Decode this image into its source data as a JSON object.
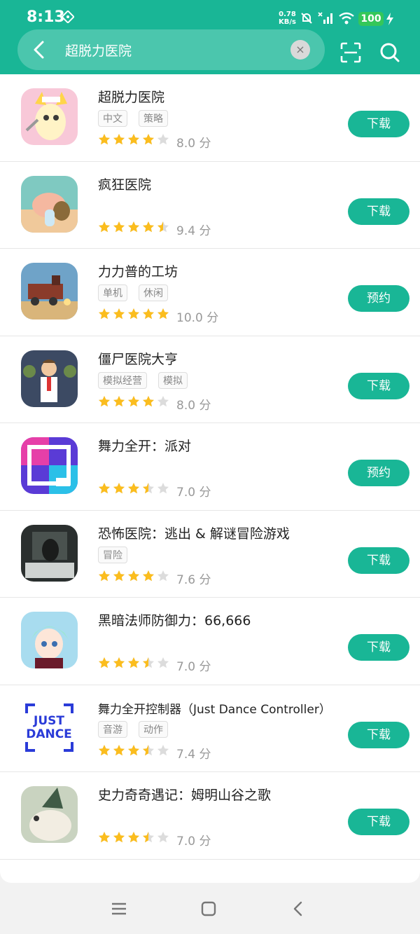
{
  "status": {
    "time": "8:13",
    "speed_value": "0.78",
    "speed_unit": "KB/s",
    "battery": "100"
  },
  "search": {
    "value": "超脱力医院",
    "clear_label": "×"
  },
  "colors": {
    "accent": "#19b696",
    "star_full": "#fbbd1e",
    "star_empty": "#dcdcdc"
  },
  "apps": [
    {
      "name": "超脱力医院",
      "tags": [
        "中文",
        "策略"
      ],
      "rating": 4,
      "score": "8.0 分",
      "action": "下载"
    },
    {
      "name": "疯狂医院",
      "tags": [],
      "rating": 4.5,
      "score": "9.4 分",
      "action": "下载"
    },
    {
      "name": "力力普的工坊",
      "tags": [
        "单机",
        "休闲"
      ],
      "rating": 5,
      "score": "10.0 分",
      "action": "预约"
    },
    {
      "name": "僵尸医院大亨",
      "tags": [
        "模拟经营",
        "模拟"
      ],
      "rating": 4,
      "score": "8.0 分",
      "action": "下载"
    },
    {
      "name": "舞力全开：派对",
      "tags": [],
      "rating": 3.5,
      "score": "7.0 分",
      "action": "预约"
    },
    {
      "name": "恐怖医院：逃出 & 解谜冒险游戏",
      "tags": [
        "冒险"
      ],
      "rating": 4,
      "score": "7.6 分",
      "action": "下载"
    },
    {
      "name": "黑暗法师防御力：66,666",
      "tags": [],
      "rating": 3.5,
      "score": "7.0 分",
      "action": "下载"
    },
    {
      "name": "舞力全开控制器（Just Dance Controller）",
      "tags": [
        "音游",
        "动作"
      ],
      "rating": 3.5,
      "score": "7.4 分",
      "action": "下载"
    },
    {
      "name": "史力奇奇遇记：姆明山谷之歌",
      "tags": [],
      "rating": 3.5,
      "score": "7.0 分",
      "action": "下载"
    }
  ],
  "app_icon_names": [
    "icon-art-nurse-cat",
    "icon-art-crazy-hospital",
    "icon-art-train",
    "icon-art-zombie-doctor",
    "icon-art-dance-party",
    "icon-art-horror",
    "icon-art-mage",
    "icon-art-just-dance-logo",
    "icon-art-snufkin"
  ],
  "navbar": {
    "icons": [
      "menu-icon",
      "home-icon",
      "back-icon"
    ]
  }
}
